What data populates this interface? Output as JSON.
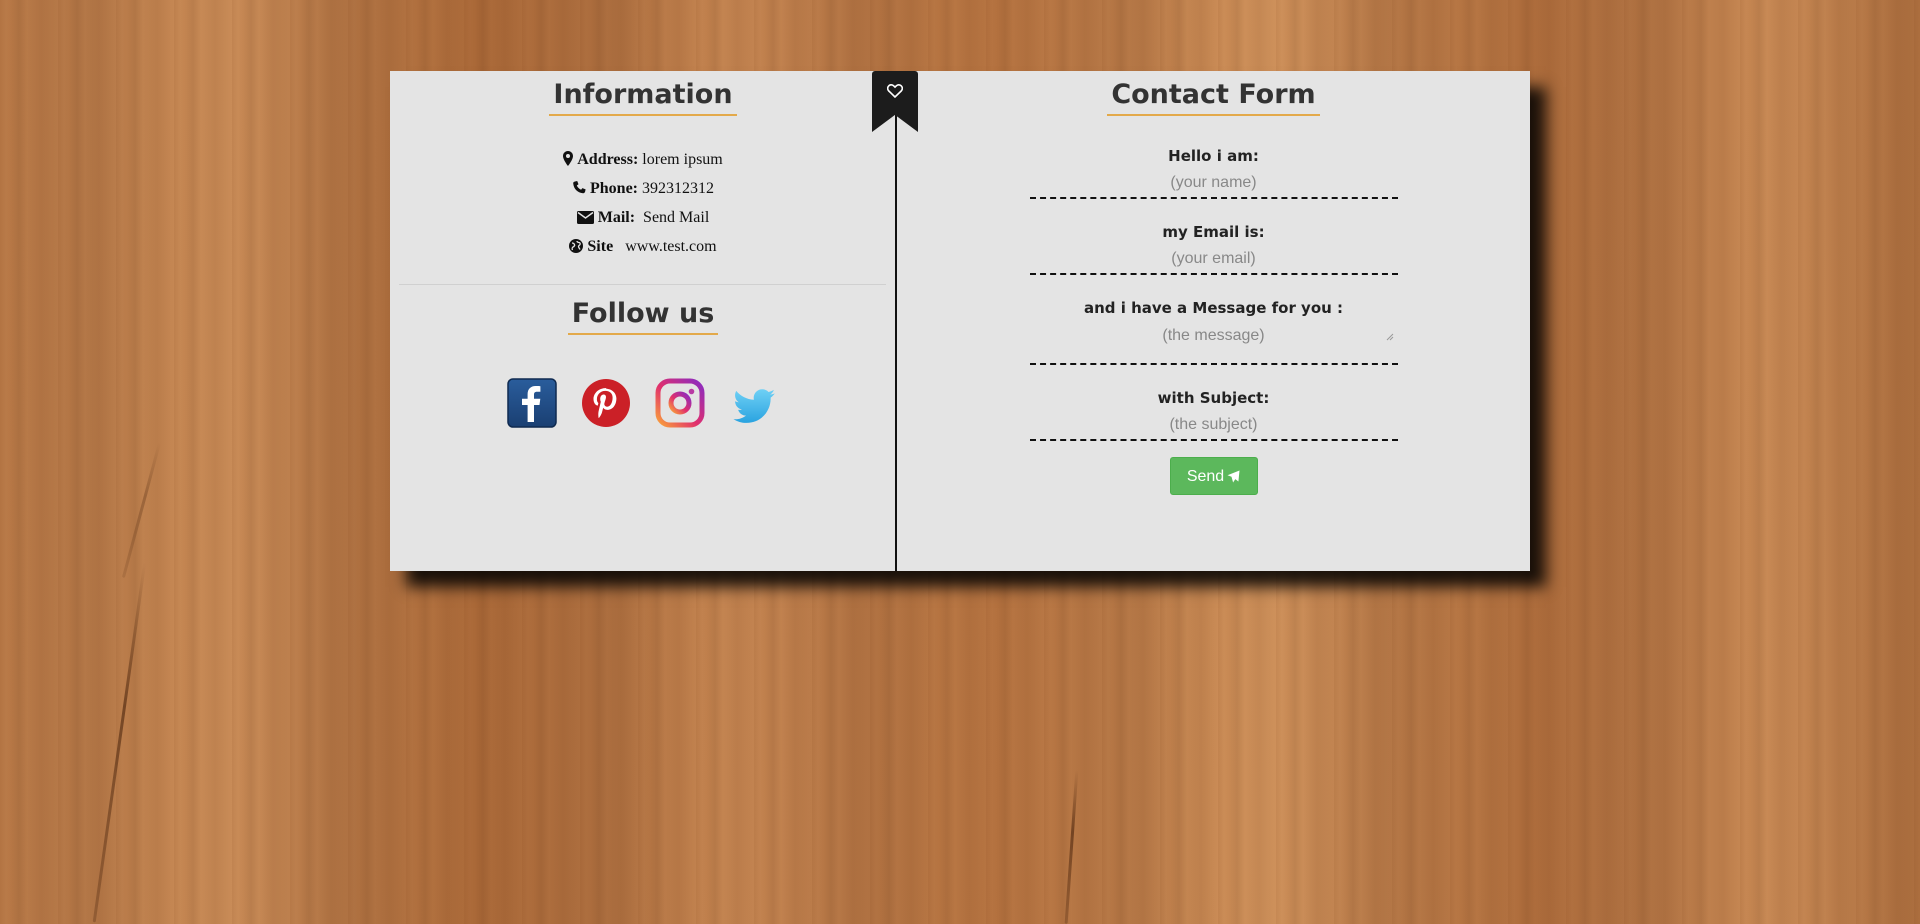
{
  "info": {
    "title": "Information",
    "address_label": "Address:",
    "address_value": "lorem ipsum",
    "phone_label": "Phone:",
    "phone_value": "392312312",
    "mail_label": "Mail:",
    "mail_value": "Send Mail",
    "site_label": "Site",
    "site_value": "www.test.com"
  },
  "follow": {
    "title": "Follow us",
    "networks": [
      "facebook",
      "pinterest",
      "instagram",
      "twitter"
    ]
  },
  "contact": {
    "title": "Contact Form",
    "name_label": "Hello i am:",
    "name_placeholder": "(your name)",
    "email_label": "my Email is:",
    "email_placeholder": "(your email)",
    "message_label": "and i have a Message for you :",
    "message_placeholder": "(the message)",
    "subject_label": "with Subject:",
    "subject_placeholder": "(the subject)",
    "send_label": "Send"
  },
  "colors": {
    "accent_underline": "#e3a94a",
    "send_button": "#5cb85c",
    "card_bg": "#e4e4e4"
  },
  "icons": [
    "map-marker-icon",
    "phone-icon",
    "envelope-icon",
    "globe-icon",
    "heart-icon",
    "plane-icon"
  ]
}
